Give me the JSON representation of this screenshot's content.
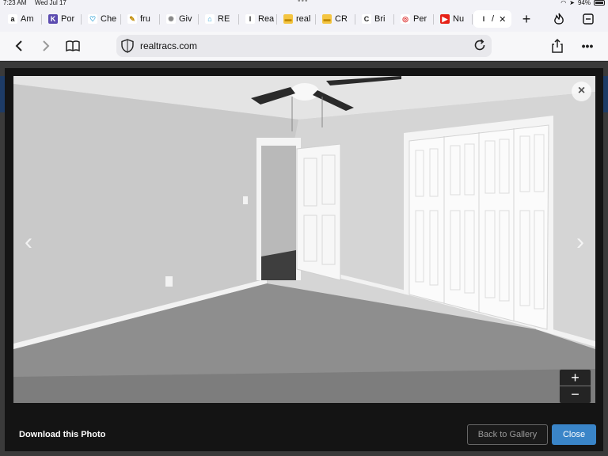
{
  "status_bar": {
    "time": "7:23 AM",
    "date": "Wed Jul 17",
    "battery": "94%"
  },
  "tabs": [
    {
      "label": "Am",
      "icon": "amazon-icon",
      "fav": "a",
      "color": "#111111",
      "bg": "#ffffff"
    },
    {
      "label": "Por",
      "icon": "portal-icon",
      "fav": "K",
      "color": "#ffffff",
      "bg": "#5b4bb0"
    },
    {
      "label": "Che",
      "icon": "heart-icon",
      "fav": "♡",
      "color": "#2a9fd6",
      "bg": "#ffffff"
    },
    {
      "label": "fru",
      "icon": "pencil-icon",
      "fav": "✎",
      "color": "#c08a00",
      "bg": "#ffffff"
    },
    {
      "label": "Giv",
      "icon": "sun-icon",
      "fav": "✺",
      "color": "#888888",
      "bg": "#ffffff"
    },
    {
      "label": "RE",
      "icon": "house-icon",
      "fav": "⌂",
      "color": "#2a9fd6",
      "bg": "#ffffff"
    },
    {
      "label": "Rea",
      "icon": "realtracs-icon",
      "fav": "I",
      "color": "#222222",
      "bg": "#ffffff"
    },
    {
      "label": "real",
      "icon": "realtor-icon",
      "fav": "▬",
      "color": "#c08a00",
      "bg": "#f4c542"
    },
    {
      "label": "CR",
      "icon": "realtor-icon",
      "fav": "▬",
      "color": "#c08a00",
      "bg": "#f4c542"
    },
    {
      "label": "Bri",
      "icon": "c-icon",
      "fav": "C",
      "color": "#222222",
      "bg": "#ffffff"
    },
    {
      "label": "Per",
      "icon": "lifebuoy-icon",
      "fav": "◎",
      "color": "#d33",
      "bg": "#ffffff"
    },
    {
      "label": "Nu",
      "icon": "youtube-icon",
      "fav": "▶",
      "color": "#ffffff",
      "bg": "#e62117"
    },
    {
      "label": "/",
      "icon": "realtracs-icon",
      "fav": "I",
      "color": "#222222",
      "bg": "#ffffff"
    }
  ],
  "url": "realtracs.com",
  "lightbox": {
    "download_label": "Download this Photo",
    "back_label": "Back to Gallery",
    "close_label": "Close",
    "zoom_in": "+",
    "zoom_out": "−",
    "close_glyph": "×",
    "prev_glyph": "‹",
    "next_glyph": "›"
  },
  "colors": {
    "accent": "#3a85c8",
    "lightbox_bg": "#141414"
  }
}
